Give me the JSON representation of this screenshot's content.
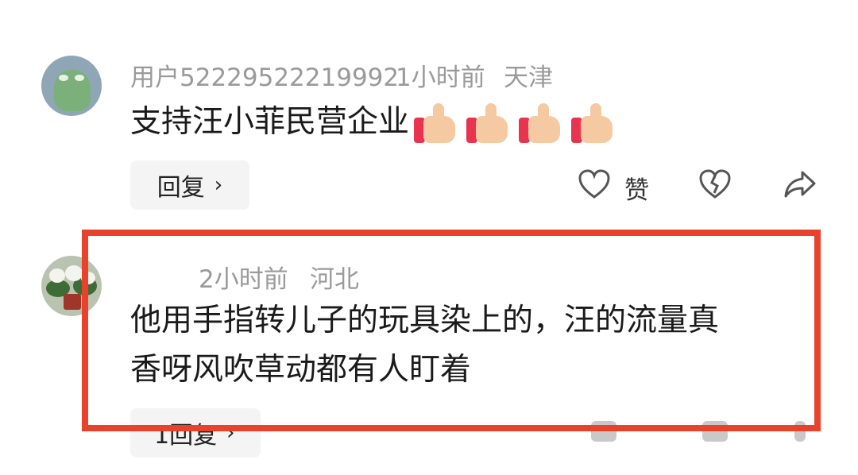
{
  "comments": [
    {
      "username": "用户52229522219992",
      "time": "1小时前",
      "location": "天津",
      "text": "支持汪小菲民营企业",
      "reply_label": "回复",
      "like_label": "赞",
      "icons": [
        "heart-icon",
        "broken-heart-icon",
        "share-icon"
      ]
    },
    {
      "username": "",
      "time": "2小时前",
      "location": "河北",
      "text_line1": "他用手指转儿子的玩具染上的，汪的流量真",
      "text_line2": "香呀风吹草动都有人盯着",
      "reply_label": "1回复"
    }
  ],
  "colors": {
    "highlight_border": "#e8412c",
    "meta_text": "#9a9a9a",
    "comment_text": "#1a1a1a",
    "reply_bg": "#f4f4f4"
  }
}
